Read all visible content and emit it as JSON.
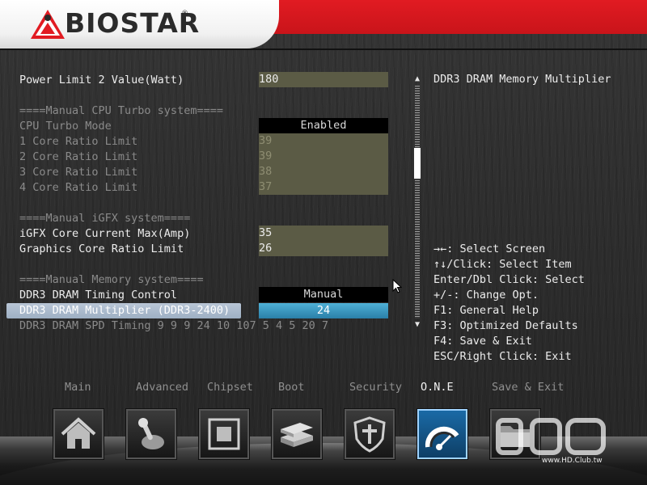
{
  "brand": {
    "name": "BIOSTAR",
    "reg_mark": "®",
    "brand_red": "#e11b22"
  },
  "settings": {
    "power_limit_2": {
      "label": "Power Limit 2 Value(Watt)",
      "value": "180"
    },
    "cpu_turbo_header": "====Manual CPU Turbo system====",
    "cpu_turbo_mode": {
      "label": "CPU Turbo Mode",
      "value": "Enabled"
    },
    "core1": {
      "label": "1 Core Ratio Limit",
      "value": "39"
    },
    "core2": {
      "label": "2 Core Ratio Limit",
      "value": "39"
    },
    "core3": {
      "label": "3 Core Ratio Limit",
      "value": "38"
    },
    "core4": {
      "label": "4 Core Ratio Limit",
      "value": "37"
    },
    "igfx_header": "====Manual iGFX system====",
    "igfx_current": {
      "label": "iGFX Core Current Max(Amp)",
      "value": "35"
    },
    "gfx_ratio": {
      "label": "Graphics Core Ratio Limit",
      "value": "26"
    },
    "memory_header": "====Manual Memory system====",
    "dram_timing_control": {
      "label": "DDR3 DRAM Timing Control",
      "value": "Manual"
    },
    "dram_multiplier": {
      "label": "DDR3 DRAM Multiplier  (DDR3-2400)",
      "value": "24"
    },
    "dram_spd_timing": "DDR3 DRAM SPD Timing 9 9 9 24 10 107 5 4 5 20 7"
  },
  "help": {
    "title": "DDR3 DRAM Memory Multiplier",
    "keys": [
      "→←: Select Screen",
      "↑↓/Click: Select Item",
      "Enter/Dbl Click: Select",
      "+/-: Change Opt.",
      "F1: General Help",
      "F3: Optimized Defaults",
      "F4: Save & Exit",
      "ESC/Right Click: Exit"
    ]
  },
  "scroll": {
    "up_arrow": "▲",
    "down_arrow": "▼"
  },
  "tabs": [
    {
      "label": "Main"
    },
    {
      "label": "Advanced"
    },
    {
      "label": "Chipset"
    },
    {
      "label": "Boot"
    },
    {
      "label": "Security"
    },
    {
      "label": "O.N.E",
      "active": true
    },
    {
      "label": "Save & Exit"
    }
  ],
  "dock_icons": [
    "home-icon",
    "joystick-icon",
    "chip-icon",
    "drives-icon",
    "shield-icon",
    "speedometer-icon",
    "save-exit-icon"
  ],
  "watermark": {
    "title": "HD CLUB",
    "url": "www.HD.Club.tw"
  }
}
